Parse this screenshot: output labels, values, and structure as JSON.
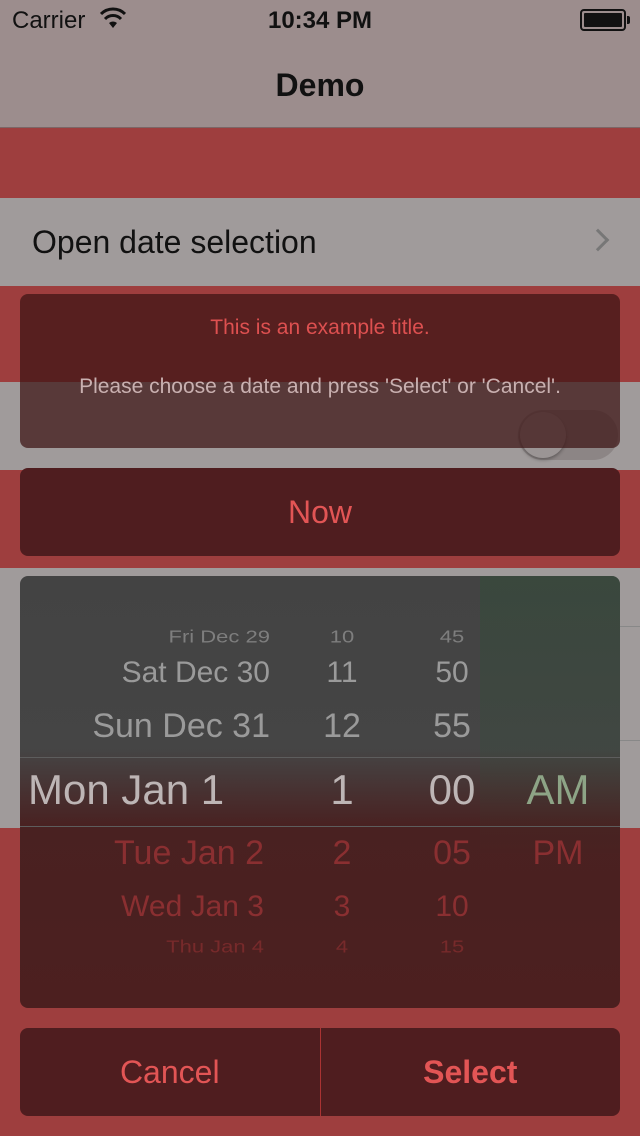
{
  "status": {
    "carrier": "Carrier",
    "time": "10:34 PM"
  },
  "nav": {
    "title": "Demo"
  },
  "table": {
    "open_date_label": "Open date selection"
  },
  "popup": {
    "title": "This is an example title.",
    "message": "Please choose a date and press 'Select' or 'Cancel'.",
    "now_label": "Now",
    "cancel_label": "Cancel",
    "select_label": "Select"
  },
  "picker": {
    "dates": [
      "Fri Dec 29",
      "Sat Dec 30",
      "Sun Dec 31",
      "Mon Jan 1",
      "Tue Jan 2",
      "Wed Jan 3",
      "Thu Jan 4"
    ],
    "hours": [
      "10",
      "11",
      "12",
      "1",
      "2",
      "3",
      "4"
    ],
    "minutes": [
      "45",
      "50",
      "55",
      "00",
      "05",
      "10",
      "15"
    ],
    "ampm": [
      "AM",
      "PM"
    ],
    "selected": {
      "date": "Mon Jan 1",
      "hour": "1",
      "minute": "00",
      "ampm": "AM"
    }
  },
  "colors": {
    "background": "#9e3e3e",
    "panel": "#4f1d1f",
    "accent": "#e25555"
  }
}
